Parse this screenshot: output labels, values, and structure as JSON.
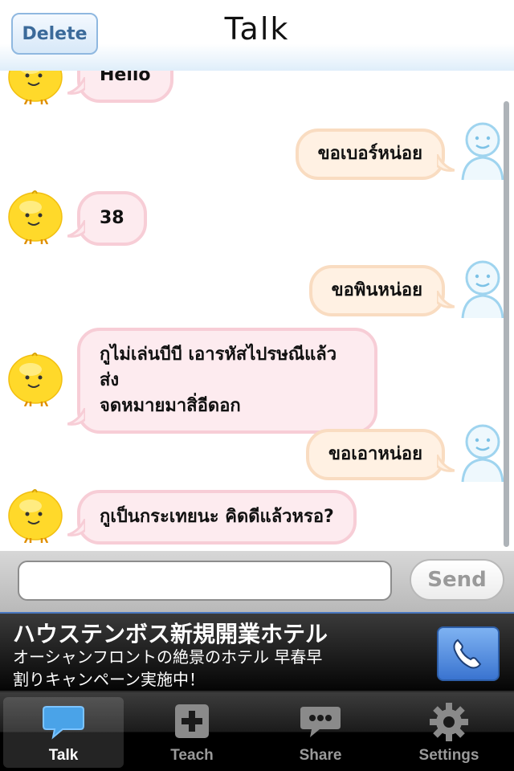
{
  "header": {
    "title": "Talk",
    "delete_label": "Delete"
  },
  "messages": [
    {
      "side": "bot",
      "text": "Hello"
    },
    {
      "side": "user",
      "text": "ขอเบอร์หน่อย"
    },
    {
      "side": "bot",
      "text": "38"
    },
    {
      "side": "user",
      "text": "ขอพินหน่อย"
    },
    {
      "side": "bot",
      "text_line1": "กูไม่เล่นบีบี เอารหัสไปรษณีแล้วส่ง",
      "text_line2": "จดหมายมาสิ่อีดอก"
    },
    {
      "side": "user",
      "text": "ขอเอาหน่อย"
    },
    {
      "side": "bot",
      "text": "กูเป็นกระเทยนะ คิดดีแล้วหรอ?"
    }
  ],
  "composer": {
    "value": "",
    "placeholder": "",
    "send_label": "Send"
  },
  "ad": {
    "title": "ハウステンボス新規開業ホテル",
    "line1": "オーシャンフロントの絶景のホテル 早春早",
    "line2": "割りキャンペーン実施中！"
  },
  "tabs": [
    {
      "label": "Talk",
      "icon": "speech-bubble-icon",
      "active": true
    },
    {
      "label": "Teach",
      "icon": "plus-box-icon",
      "active": false
    },
    {
      "label": "Share",
      "icon": "chat-dots-icon",
      "active": false
    },
    {
      "label": "Settings",
      "icon": "gear-icon",
      "active": false
    }
  ],
  "colors": {
    "bot_bubble": "#fdebef",
    "user_bubble": "#fff1e3",
    "bot_avatar": "#ffd92a",
    "user_avatar": "#bfe6f8",
    "tab_active": "#ffffff"
  }
}
